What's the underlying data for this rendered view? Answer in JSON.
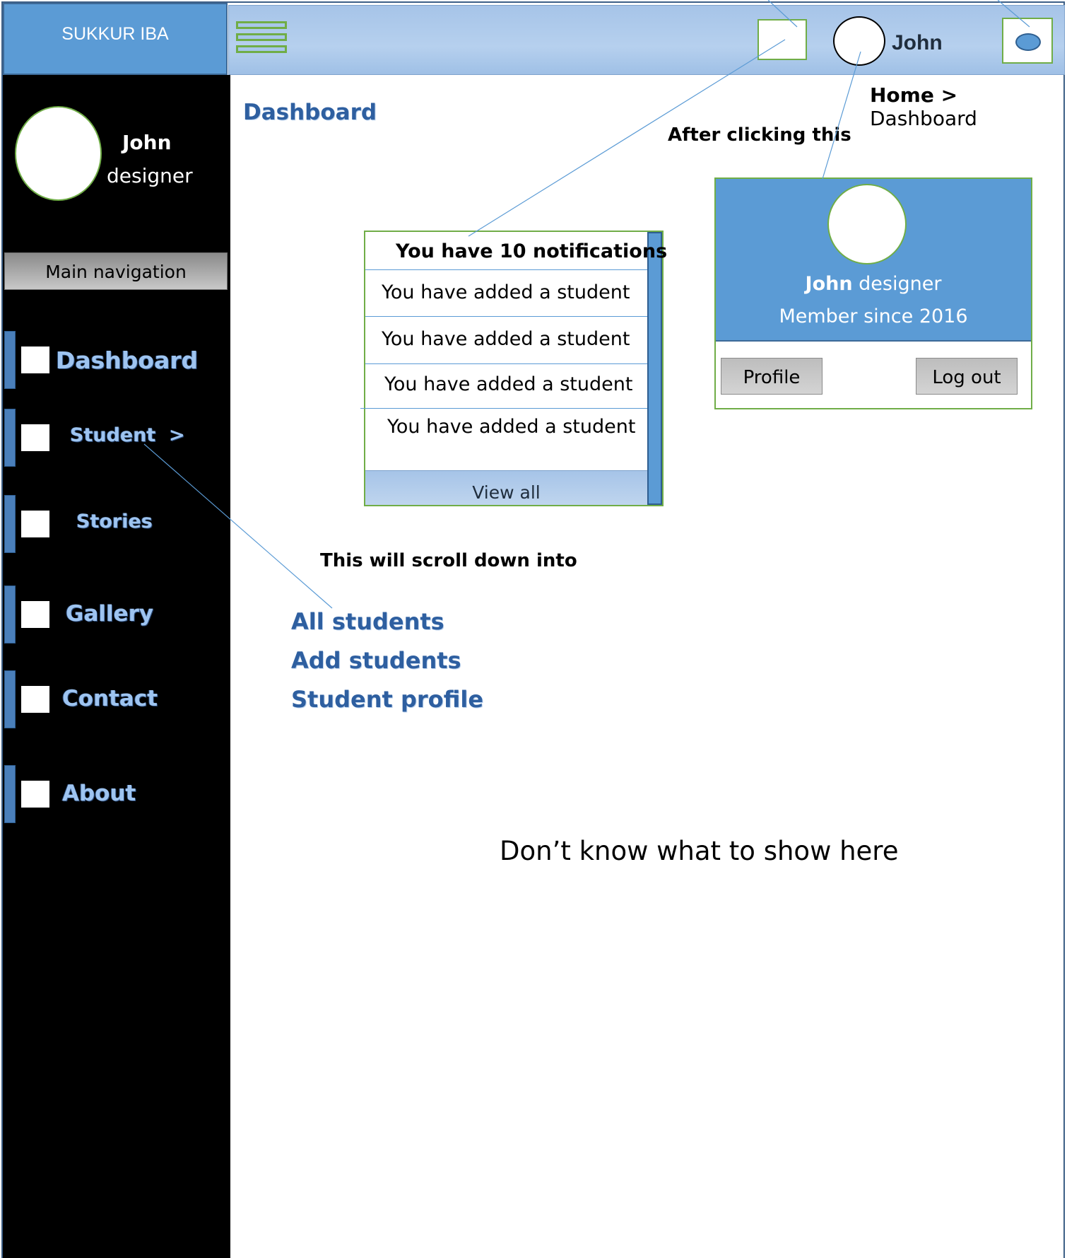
{
  "brand": {
    "title": "SUKKUR IBA"
  },
  "topbar": {
    "user_name": "John",
    "colors": {
      "bar": "#a6c4e8",
      "accent_green": "#70ad47"
    }
  },
  "sidebar": {
    "user_name": "John",
    "user_role": "designer",
    "section_label": "Main navigation",
    "items": [
      {
        "label": "Dashboard",
        "icon": "square-icon"
      },
      {
        "label": "Student  >",
        "icon": "square-icon"
      },
      {
        "label": "Stories",
        "icon": "square-icon"
      },
      {
        "label": "Gallery",
        "icon": "square-icon"
      },
      {
        "label": "Contact",
        "icon": "square-icon"
      },
      {
        "label": "About",
        "icon": "square-icon"
      }
    ]
  },
  "main": {
    "title": "Dashboard",
    "breadcrumb": {
      "home": "Home >",
      "current": "Dashboard"
    },
    "annotation_click": "After clicking this",
    "annotation_scroll": "This will scroll down into",
    "placeholder": "Don’t know what to show here"
  },
  "notifications": {
    "header": "You have 10 notifications",
    "items": [
      "You have added a student",
      "You have added a student",
      "You have added a student",
      "You have added a student"
    ],
    "view_all": "View all"
  },
  "profile_card": {
    "name": "John",
    "role": " designer",
    "member_since": "Member since 2016",
    "profile_button": "Profile",
    "logout_button": "Log out"
  },
  "student_submenu": [
    "All students",
    "Add students",
    "Student profile"
  ]
}
